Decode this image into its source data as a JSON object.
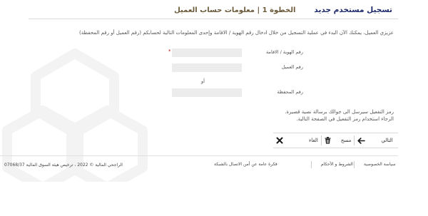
{
  "header": {
    "title": "تسجيل مستخدم جديد",
    "step": "الخطوة 1 | معلومات حساب العميل"
  },
  "intro_text": "عزيزي العميل، يمكنك الآن البدء في عملية التسجيل من خلال ادخال رقم الهوية / الاقامة وإحدى المعلومات التالية لحسابكم (رقم العميل أو رقم المحفظة)",
  "form": {
    "id_label": "رقم الهوية / الاقامة",
    "id_required": "*",
    "id_value": "",
    "customer_label": "رقم العميل",
    "customer_value": "",
    "or_text": "أو",
    "portfolio_label": "رقم المحفظة",
    "portfolio_value": ""
  },
  "notes": {
    "line1": "رمز التفعيل سيرسل الى جوالك برسالة نصية قصيرة.",
    "line2": "الرجاء استخدام رمز التفعيل في الصفحة التالية."
  },
  "buttons": {
    "next": "التالي",
    "clear": "مسح",
    "cancel": "الغاء"
  },
  "footer": {
    "privacy": "سياسة الخصوصية",
    "terms": "الشروط و الأحكام",
    "security": "فكرة عامة عن أمن الاتصال بالشبكة",
    "copyright": "الراجحي المالية © 2022 ، ترخيص هيئة السوق المالية 07068/37"
  },
  "colors": {
    "title": "#1e2a6a",
    "step": "#6b5a3a",
    "input_bg": "#ececec"
  }
}
